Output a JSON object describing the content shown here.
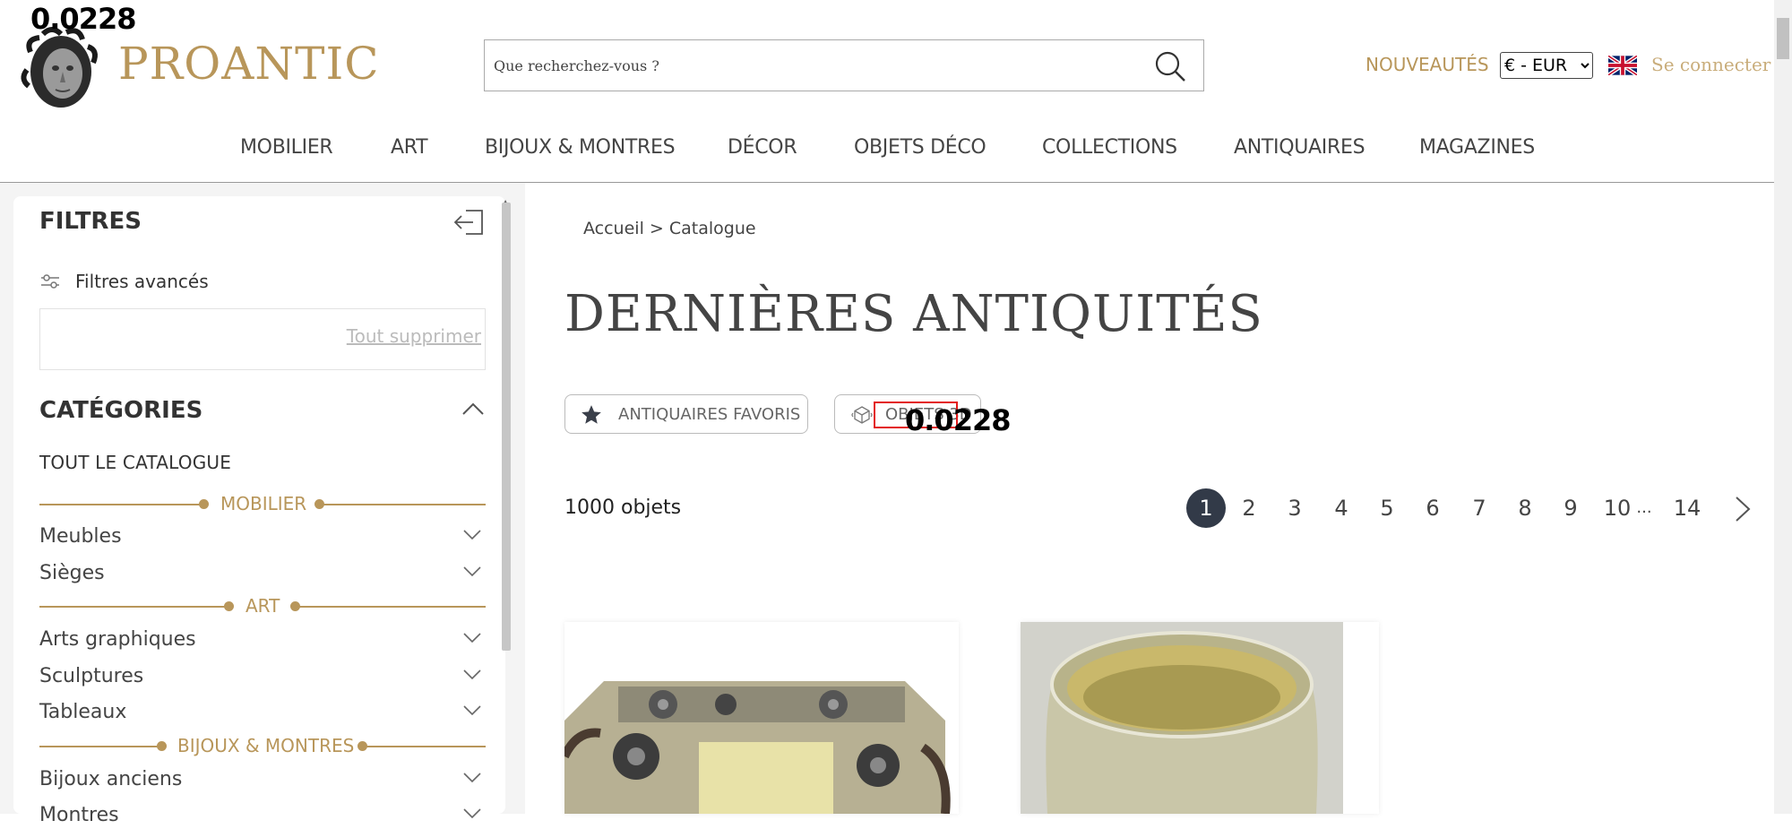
{
  "overlay": {
    "top_left_value": "0.0228",
    "mid_value": "0.0228"
  },
  "header": {
    "brand": "PROANTIC",
    "search_placeholder": "Que recherchez-vous ?",
    "nouveautes": "NOUVEAUTÉS",
    "currency_selected": "€ - EUR",
    "login": "Se connecter"
  },
  "nav": {
    "items": [
      "MOBILIER",
      "ART",
      "BIJOUX & MONTRES",
      "DÉCOR",
      "OBJETS DÉCO",
      "COLLECTIONS",
      "ANTIQUAIRES",
      "MAGAZINES"
    ]
  },
  "sidebar": {
    "filters_title": "FILTRES",
    "advanced_filters": "Filtres avancés",
    "clear_all": "Tout supprimer",
    "categories_title": "CATÉGORIES",
    "all_catalogue": "TOUT LE CATALOGUE",
    "sections": [
      {
        "title": "MOBILIER",
        "items": [
          "Meubles",
          "Sièges"
        ]
      },
      {
        "title": "ART",
        "items": [
          "Arts graphiques",
          "Sculptures",
          "Tableaux"
        ]
      },
      {
        "title": "BIJOUX & MONTRES",
        "items": [
          "Bijoux anciens",
          "Montres"
        ]
      }
    ]
  },
  "main": {
    "breadcrumb": {
      "home": "Accueil",
      "sep": " > ",
      "current": "Catalogue"
    },
    "title": "DERNIÈRES ANTIQUITÉS",
    "pills": {
      "favorites": "ANTIQUAIRES FAVORIS",
      "objects": "OBJETS 3D"
    },
    "count": "1000 objets",
    "pages": [
      "1",
      "2",
      "3",
      "4",
      "5",
      "6",
      "7",
      "8",
      "9",
      "10",
      "...",
      "14"
    ],
    "active_page": "1"
  },
  "colors": {
    "gold": "#b8965a",
    "active_page": "#323a48",
    "highlight": "#e31b1b"
  }
}
